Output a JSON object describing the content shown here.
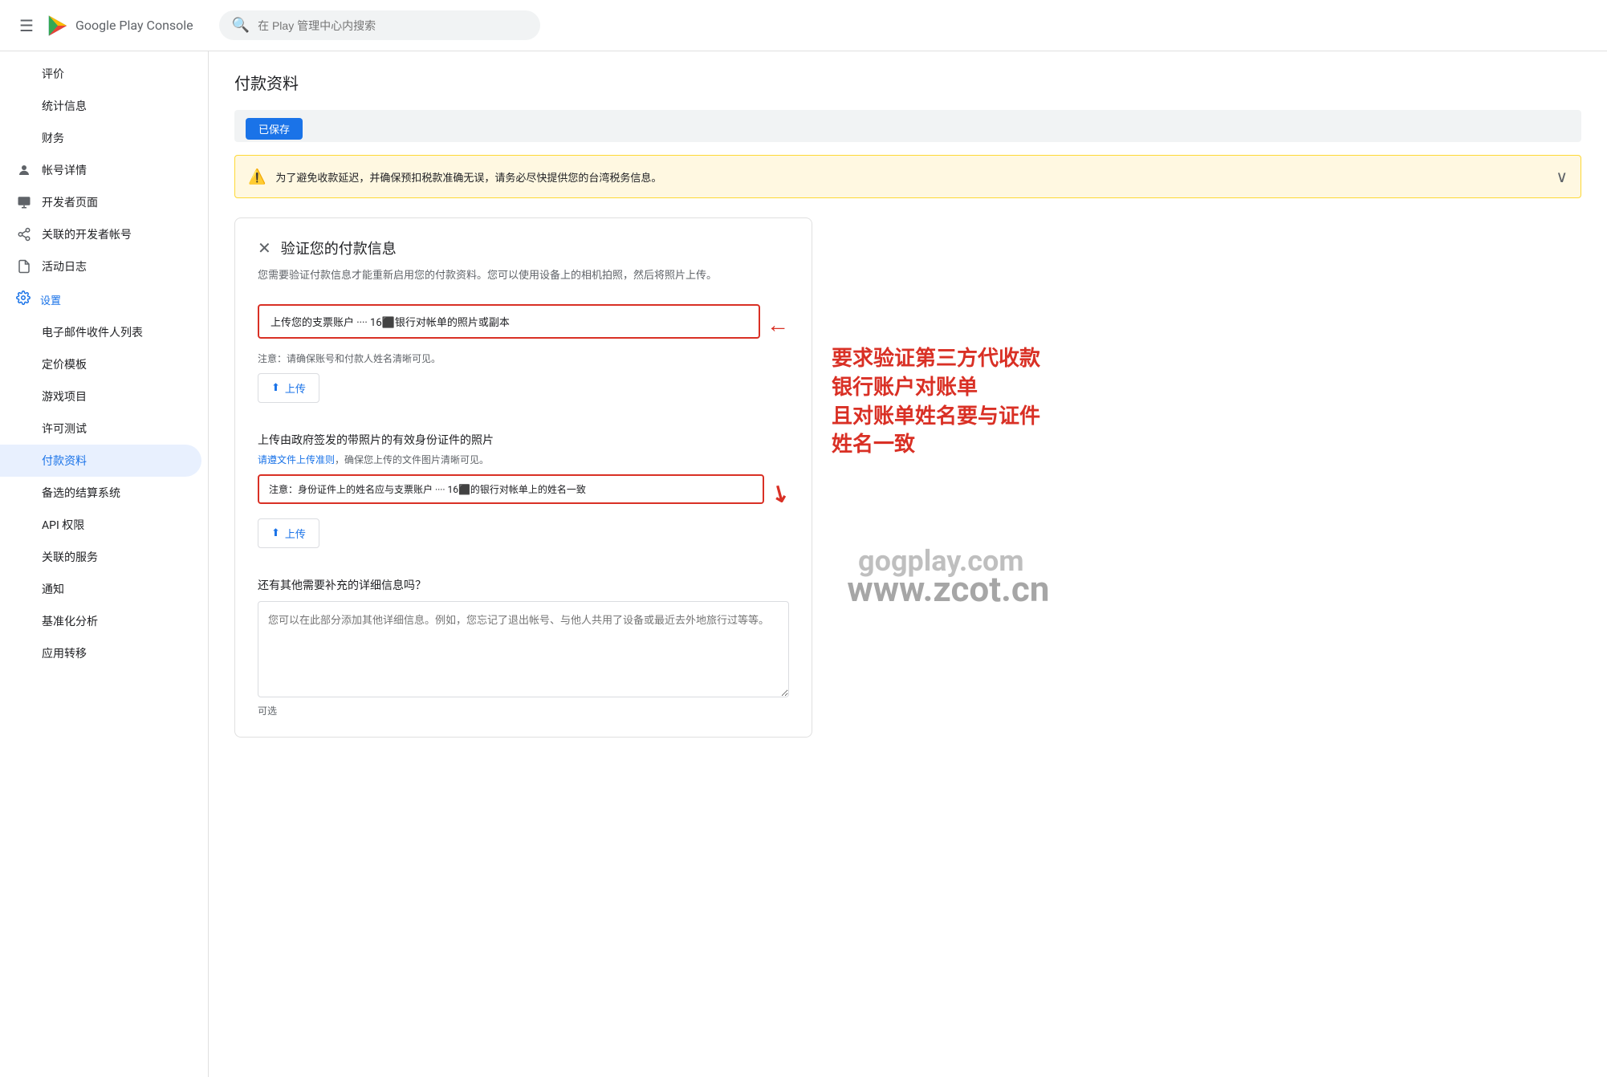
{
  "header": {
    "menu_icon": "☰",
    "logo_text": "Google Play Console",
    "search_placeholder": "在 Play 管理中心内搜索"
  },
  "sidebar": {
    "items": [
      {
        "id": "review",
        "label": "评价",
        "icon": "",
        "has_icon": false
      },
      {
        "id": "stats",
        "label": "统计信息",
        "icon": "",
        "has_icon": false
      },
      {
        "id": "finance",
        "label": "财务",
        "icon": "",
        "has_icon": false
      },
      {
        "id": "account",
        "label": "帐号详情",
        "icon": "👤",
        "has_icon": true
      },
      {
        "id": "devpage",
        "label": "开发者页面",
        "icon": "🖥",
        "has_icon": true
      },
      {
        "id": "linkeddev",
        "label": "关联的开发者帐号",
        "icon": "🔗",
        "has_icon": true
      },
      {
        "id": "actlog",
        "label": "活动日志",
        "icon": "📄",
        "has_icon": true
      },
      {
        "id": "settings",
        "label": "设置",
        "icon": "⚙",
        "has_icon": true
      },
      {
        "id": "email_list",
        "label": "电子邮件收件人列表",
        "icon": "",
        "has_icon": false
      },
      {
        "id": "pricing",
        "label": "定价模板",
        "icon": "",
        "has_icon": false
      },
      {
        "id": "game",
        "label": "游戏项目",
        "icon": "",
        "has_icon": false
      },
      {
        "id": "license",
        "label": "许可测试",
        "icon": "",
        "has_icon": false
      },
      {
        "id": "payment",
        "label": "付款资料",
        "icon": "",
        "has_icon": false,
        "active": true
      },
      {
        "id": "billing",
        "label": "备选的结算系统",
        "icon": "",
        "has_icon": false
      },
      {
        "id": "api",
        "label": "API 权限",
        "icon": "",
        "has_icon": false
      },
      {
        "id": "linked_services",
        "label": "关联的服务",
        "icon": "",
        "has_icon": false
      },
      {
        "id": "notify",
        "label": "通知",
        "icon": "",
        "has_icon": false
      },
      {
        "id": "analytics",
        "label": "基准化分析",
        "icon": "",
        "has_icon": false
      },
      {
        "id": "transfer",
        "label": "应用转移",
        "icon": "",
        "has_icon": false
      }
    ]
  },
  "main": {
    "page_title": "付款资料",
    "warning": {
      "text": "为了避免收款延迟，并确保预扣税款准确无误，请务必尽快提供您的台湾税务信息。",
      "expand_icon": "∨"
    },
    "verify_card": {
      "title": "验证您的付款信息",
      "close_icon": "✕",
      "description": "您需要验证付款信息才能重新启用您的付款资料。您可以使用设备上的相机拍照，然后将照片上传。",
      "section1": {
        "upload_box_text": "上传您的支票账户 ···· 16⬛银行对帐单的照片或副本",
        "note": "注意：请确保账号和付款人姓名清晰可见。",
        "upload_btn": "上传"
      },
      "section2": {
        "title": "上传由政府签发的带照片的有效身份证件的照片",
        "link_text": "请遵文件上传准则",
        "note_after_link": "，确保您上传的文件图片清晰可见。",
        "note_red": "注意：身份证件上的姓名应与支票账户 ···· 16⬛的银行对帐单上的姓名一致",
        "upload_btn": "上传"
      },
      "additional": {
        "label": "还有其他需要补充的详细信息吗？",
        "placeholder": "您可以在此部分添加其他详细信息。例如，您忘记了退出帐号、与他人共用了设备或最近去外地旅行过等等。",
        "optional": "可选"
      }
    },
    "annotation": {
      "line1": "要求验证第三方代收款",
      "line2": "银行账户对账单",
      "line3": "且对账单姓名要与证件",
      "line4": "姓名一致"
    },
    "watermark1": "gogplay.com",
    "watermark2": "www.zcot.cn"
  }
}
